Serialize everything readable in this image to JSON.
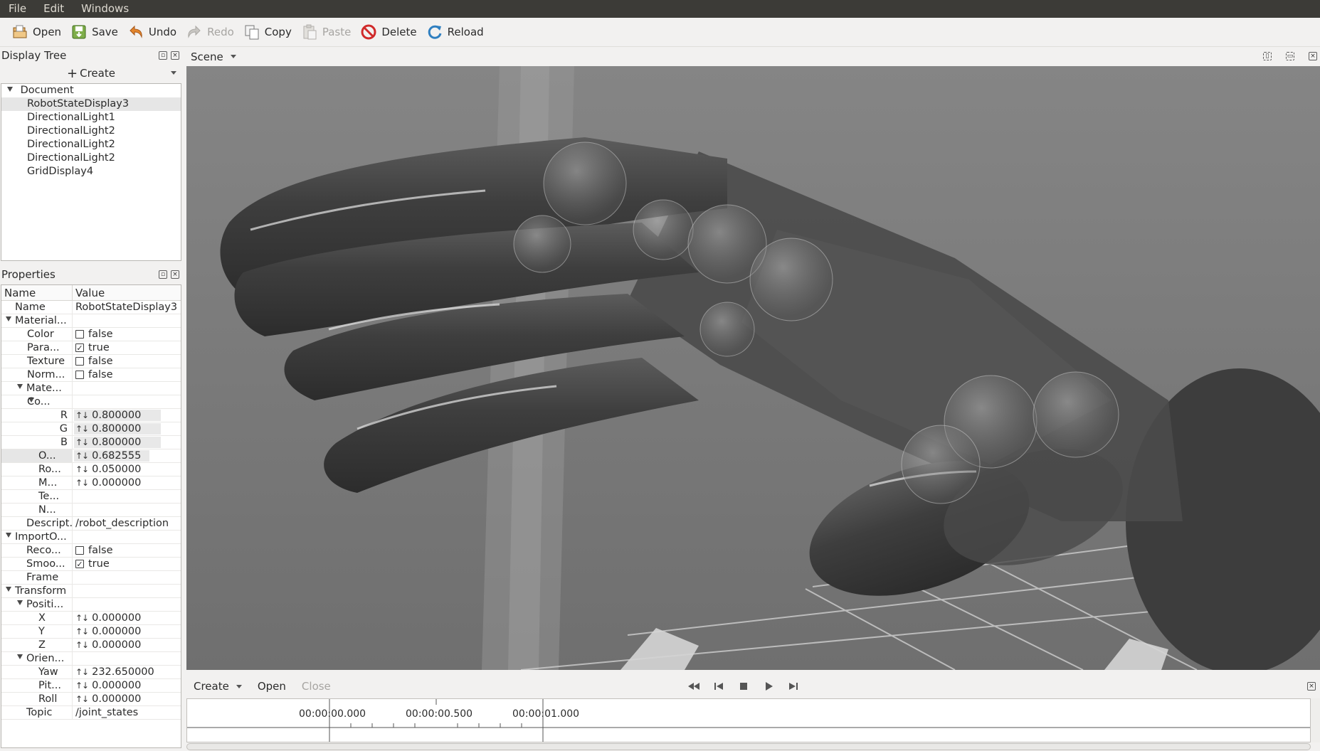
{
  "menubar": [
    "File",
    "Edit",
    "Windows"
  ],
  "toolbar": {
    "open": "Open",
    "save": "Save",
    "undo": "Undo",
    "redo": "Redo",
    "copy": "Copy",
    "paste": "Paste",
    "delete": "Delete",
    "reload": "Reload"
  },
  "display_tree": {
    "title": "Display Tree",
    "create_label": "Create",
    "root": "Document",
    "items": [
      "RobotStateDisplay3",
      "DirectionalLight1",
      "DirectionalLight2",
      "DirectionalLight2",
      "DirectionalLight2",
      "GridDisplay4"
    ]
  },
  "properties": {
    "title": "Properties",
    "col_name": "Name",
    "col_value": "Value",
    "rows": [
      {
        "name": "Name",
        "value": "RobotStateDisplay3"
      },
      {
        "name": "Material..."
      },
      {
        "name": "Color",
        "value": "false",
        "checked": false
      },
      {
        "name": "Para...",
        "value": "true",
        "checked": true
      },
      {
        "name": "Texture",
        "value": "false",
        "checked": false
      },
      {
        "name": "Norm...",
        "value": "false",
        "checked": false
      },
      {
        "name": "Mate..."
      },
      {
        "name": "Co..."
      },
      {
        "name": "R",
        "value": "0.800000"
      },
      {
        "name": "G",
        "value": "0.800000"
      },
      {
        "name": "B",
        "value": "0.800000"
      },
      {
        "name": "O...",
        "value": "0.682555"
      },
      {
        "name": "Ro...",
        "value": "0.050000"
      },
      {
        "name": "M...",
        "value": "0.000000"
      },
      {
        "name": "Te..."
      },
      {
        "name": "N..."
      },
      {
        "name": "Descript...",
        "value": "/robot_description"
      },
      {
        "name": "ImportO..."
      },
      {
        "name": "Reco...",
        "value": "false",
        "checked": false
      },
      {
        "name": "Smoo...",
        "value": "true",
        "checked": true
      },
      {
        "name": "Frame"
      },
      {
        "name": "Transform"
      },
      {
        "name": "Positi..."
      },
      {
        "name": "X",
        "value": "0.000000"
      },
      {
        "name": "Y",
        "value": "0.000000"
      },
      {
        "name": "Z",
        "value": "0.000000"
      },
      {
        "name": "Orien..."
      },
      {
        "name": "Yaw",
        "value": "232.650000"
      },
      {
        "name": "Pit...",
        "value": "0.000000"
      },
      {
        "name": "Roll",
        "value": "0.000000"
      },
      {
        "name": "Topic",
        "value": "/joint_states"
      }
    ]
  },
  "scene": {
    "title": "Scene"
  },
  "timeline": {
    "create": "Create",
    "open": "Open",
    "close": "Close",
    "ticks": [
      "00:00:00.000",
      "00:00:00.500",
      "00:00:01.000"
    ]
  },
  "colors": {
    "menubar": "#3c3b37",
    "viewport": "#7c7c7c",
    "delete": "#d02a2a",
    "reload": "#2f7fc0"
  },
  "icons": [
    "open-icon",
    "save-icon",
    "undo-icon",
    "redo-icon",
    "copy-icon",
    "paste-icon",
    "delete-icon",
    "reload-icon"
  ]
}
